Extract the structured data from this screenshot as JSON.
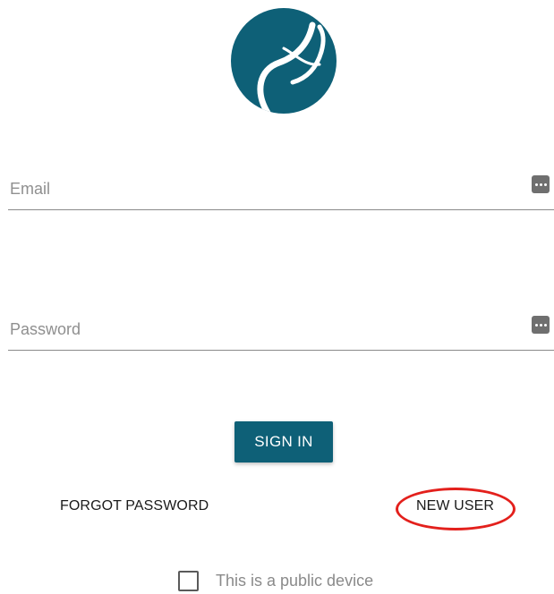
{
  "brand": {
    "logo_icon": "circular-wave-logo",
    "logo_color": "#0e6077"
  },
  "form": {
    "email_label": "Email",
    "email_value": "",
    "password_label": "Password",
    "password_value": "",
    "field_icon": "password-manager-key-icon"
  },
  "actions": {
    "sign_in_label": "SIGN IN",
    "sign_in_color": "#0e6077",
    "forgot_password_label": "FORGOT PASSWORD",
    "new_user_label": "NEW USER",
    "highlight_color": "#e3201c"
  },
  "options": {
    "public_device_label": "This is a public device",
    "public_device_checked": false
  }
}
